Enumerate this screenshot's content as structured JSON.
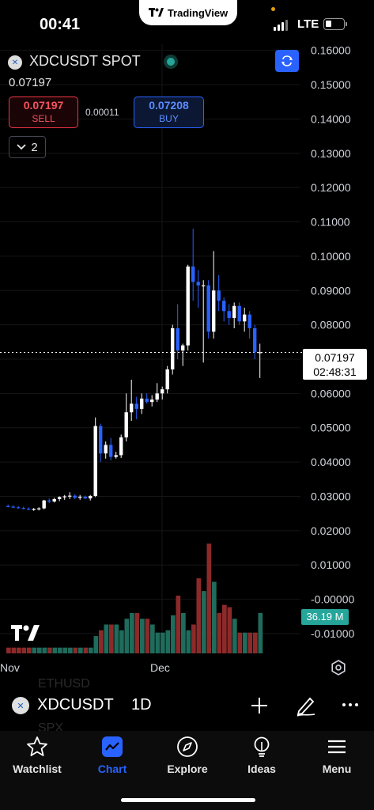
{
  "status_bar": {
    "time": "00:41",
    "app_pill": "TradingView",
    "network": "LTE"
  },
  "header": {
    "symbol_title": "XDCUSDT SPOT",
    "last_price": "0.07197",
    "sell": {
      "price": "0.07197",
      "label": "SELL"
    },
    "spread": "0.00011",
    "buy": {
      "price": "0.07208",
      "label": "BUY"
    },
    "indicator_count": "2"
  },
  "price_axis": {
    "labels": [
      "0.16000",
      "0.15000",
      "0.14000",
      "0.13000",
      "0.12000",
      "0.11000",
      "0.10000",
      "0.09000",
      "0.08000",
      "0.07000",
      "0.06000",
      "0.05000",
      "0.04000",
      "0.03000",
      "0.02000",
      "0.01000",
      "-0.00000",
      "-0.01000"
    ],
    "current_price": "0.07197",
    "countdown": "02:48:31",
    "volume_label": "36.19 M"
  },
  "time_axis": {
    "labels": [
      "Nov",
      "Dec"
    ]
  },
  "chart_data": {
    "type": "candlestick",
    "symbol": "XDCUSDT",
    "interval": "1D",
    "ylim": [
      -0.015,
      0.163
    ],
    "candles": [
      {
        "o": 0.0272,
        "h": 0.0276,
        "l": 0.0268,
        "c": 0.027
      },
      {
        "o": 0.027,
        "h": 0.0274,
        "l": 0.0266,
        "c": 0.0268
      },
      {
        "o": 0.0268,
        "h": 0.0272,
        "l": 0.0264,
        "c": 0.0266
      },
      {
        "o": 0.0266,
        "h": 0.027,
        "l": 0.0262,
        "c": 0.0264
      },
      {
        "o": 0.0264,
        "h": 0.0268,
        "l": 0.026,
        "c": 0.0262
      },
      {
        "o": 0.0262,
        "h": 0.0266,
        "l": 0.0258,
        "c": 0.0263
      },
      {
        "o": 0.0263,
        "h": 0.0268,
        "l": 0.0259,
        "c": 0.0265
      },
      {
        "o": 0.0265,
        "h": 0.029,
        "l": 0.0262,
        "c": 0.0288
      },
      {
        "o": 0.0288,
        "h": 0.0294,
        "l": 0.028,
        "c": 0.0285
      },
      {
        "o": 0.0285,
        "h": 0.0296,
        "l": 0.0282,
        "c": 0.0292
      },
      {
        "o": 0.0292,
        "h": 0.03,
        "l": 0.0286,
        "c": 0.0298
      },
      {
        "o": 0.0298,
        "h": 0.0304,
        "l": 0.029,
        "c": 0.03
      },
      {
        "o": 0.03,
        "h": 0.0312,
        "l": 0.0292,
        "c": 0.0302
      },
      {
        "o": 0.0302,
        "h": 0.0306,
        "l": 0.0292,
        "c": 0.0296
      },
      {
        "o": 0.0296,
        "h": 0.0304,
        "l": 0.029,
        "c": 0.0299
      },
      {
        "o": 0.0299,
        "h": 0.0302,
        "l": 0.0292,
        "c": 0.0294
      },
      {
        "o": 0.0294,
        "h": 0.0304,
        "l": 0.0288,
        "c": 0.0301
      },
      {
        "o": 0.0301,
        "h": 0.053,
        "l": 0.0298,
        "c": 0.0505
      },
      {
        "o": 0.0505,
        "h": 0.0512,
        "l": 0.04,
        "c": 0.0425
      },
      {
        "o": 0.0425,
        "h": 0.046,
        "l": 0.041,
        "c": 0.045
      },
      {
        "o": 0.045,
        "h": 0.047,
        "l": 0.0405,
        "c": 0.0415
      },
      {
        "o": 0.0415,
        "h": 0.043,
        "l": 0.041,
        "c": 0.042
      },
      {
        "o": 0.042,
        "h": 0.048,
        "l": 0.0412,
        "c": 0.0472
      },
      {
        "o": 0.0472,
        "h": 0.06,
        "l": 0.046,
        "c": 0.0545
      },
      {
        "o": 0.0545,
        "h": 0.064,
        "l": 0.052,
        "c": 0.057
      },
      {
        "o": 0.057,
        "h": 0.059,
        "l": 0.0525,
        "c": 0.0555
      },
      {
        "o": 0.0555,
        "h": 0.06,
        "l": 0.054,
        "c": 0.0585
      },
      {
        "o": 0.0585,
        "h": 0.06,
        "l": 0.057,
        "c": 0.0575
      },
      {
        "o": 0.0575,
        "h": 0.0595,
        "l": 0.0562,
        "c": 0.0582
      },
      {
        "o": 0.0582,
        "h": 0.063,
        "l": 0.0575,
        "c": 0.06
      },
      {
        "o": 0.06,
        "h": 0.062,
        "l": 0.0582,
        "c": 0.0612
      },
      {
        "o": 0.0612,
        "h": 0.068,
        "l": 0.06,
        "c": 0.067
      },
      {
        "o": 0.067,
        "h": 0.08,
        "l": 0.0655,
        "c": 0.079
      },
      {
        "o": 0.079,
        "h": 0.086,
        "l": 0.07,
        "c": 0.0725
      },
      {
        "o": 0.0725,
        "h": 0.0745,
        "l": 0.068,
        "c": 0.074
      },
      {
        "o": 0.074,
        "h": 0.0975,
        "l": 0.0725,
        "c": 0.097
      },
      {
        "o": 0.097,
        "h": 0.108,
        "l": 0.087,
        "c": 0.0925
      },
      {
        "o": 0.0925,
        "h": 0.096,
        "l": 0.085,
        "c": 0.0915
      },
      {
        "o": 0.0915,
        "h": 0.093,
        "l": 0.069,
        "c": 0.0915
      },
      {
        "o": 0.0915,
        "h": 0.093,
        "l": 0.076,
        "c": 0.078
      },
      {
        "o": 0.078,
        "h": 0.1015,
        "l": 0.076,
        "c": 0.09
      },
      {
        "o": 0.09,
        "h": 0.0945,
        "l": 0.084,
        "c": 0.087
      },
      {
        "o": 0.087,
        "h": 0.088,
        "l": 0.081,
        "c": 0.084
      },
      {
        "o": 0.084,
        "h": 0.086,
        "l": 0.08,
        "c": 0.082
      },
      {
        "o": 0.082,
        "h": 0.0865,
        "l": 0.079,
        "c": 0.0855
      },
      {
        "o": 0.0855,
        "h": 0.0865,
        "l": 0.08,
        "c": 0.081
      },
      {
        "o": 0.081,
        "h": 0.085,
        "l": 0.078,
        "c": 0.083
      },
      {
        "o": 0.083,
        "h": 0.084,
        "l": 0.076,
        "c": 0.079
      },
      {
        "o": 0.079,
        "h": 0.08,
        "l": 0.07,
        "c": 0.072
      },
      {
        "o": 0.072,
        "h": 0.0745,
        "l": 0.0645,
        "c": 0.072
      }
    ],
    "volume": [
      0.5,
      0.5,
      0.5,
      0.5,
      0.5,
      0.5,
      0.5,
      0.5,
      0.5,
      0.5,
      0.5,
      0.5,
      0.5,
      0.5,
      0.5,
      0.5,
      0.5,
      1.5,
      2.0,
      2.5,
      2.5,
      2.5,
      2.0,
      3.0,
      3.5,
      3.5,
      3.0,
      3.0,
      2.5,
      1.8,
      1.8,
      2.0,
      3.3,
      5.0,
      3.5,
      2.0,
      2.5,
      6.5,
      5.4,
      9.5,
      6.2,
      3.5,
      4.2,
      4.0,
      3.0,
      1.8,
      1.8,
      1.8,
      1.8,
      3.5
    ]
  },
  "bottom_toolbar": {
    "symbol": "XDCUSDT",
    "interval": "1D",
    "ghost_above": "ETHUSD",
    "ghost_below": "SPX"
  },
  "nav": {
    "items": [
      {
        "label": "Watchlist",
        "icon": "star-icon"
      },
      {
        "label": "Chart",
        "icon": "chart-icon"
      },
      {
        "label": "Explore",
        "icon": "compass-icon"
      },
      {
        "label": "Ideas",
        "icon": "lightbulb-icon"
      },
      {
        "label": "Menu",
        "icon": "hamburger-icon"
      }
    ]
  },
  "colors": {
    "up": "#ffffff",
    "down": "#2962ff",
    "vol_up": "#1f6b5c",
    "vol_down": "#8c2a2a",
    "accent": "#2962ff"
  }
}
